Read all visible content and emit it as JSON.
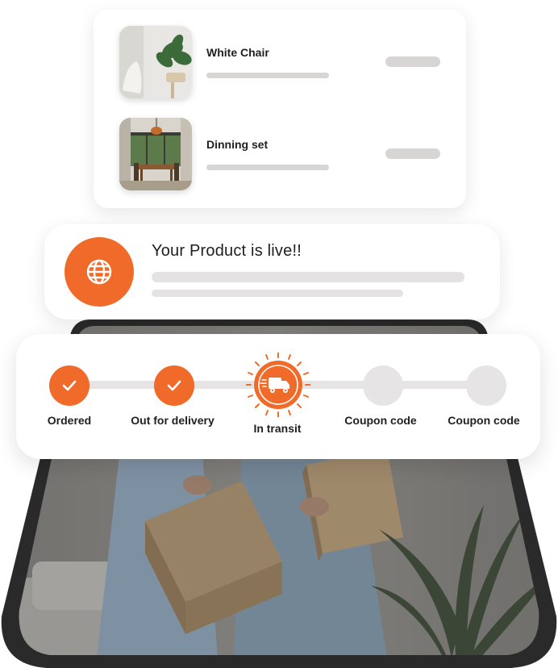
{
  "products": [
    {
      "name": "White Chair",
      "thumb_icon": "plant-chair-photo"
    },
    {
      "name": "Dinning set",
      "thumb_icon": "dining-room-photo"
    }
  ],
  "notification": {
    "title": "Your Product is live!!",
    "icon": "globe-icon"
  },
  "tracking": {
    "steps": [
      {
        "label": "Ordered",
        "state": "done",
        "icon": "check-icon"
      },
      {
        "label": "Out for delivery",
        "state": "done",
        "icon": "check-icon"
      },
      {
        "label": "In transit",
        "state": "active",
        "icon": "delivery-truck-icon"
      },
      {
        "label": "Coupon code",
        "state": "pending"
      },
      {
        "label": "Coupon code",
        "state": "pending"
      }
    ]
  },
  "colors": {
    "accent": "#f06a2a",
    "placeholder": "#d8d5d5",
    "card": "#ffffff"
  }
}
